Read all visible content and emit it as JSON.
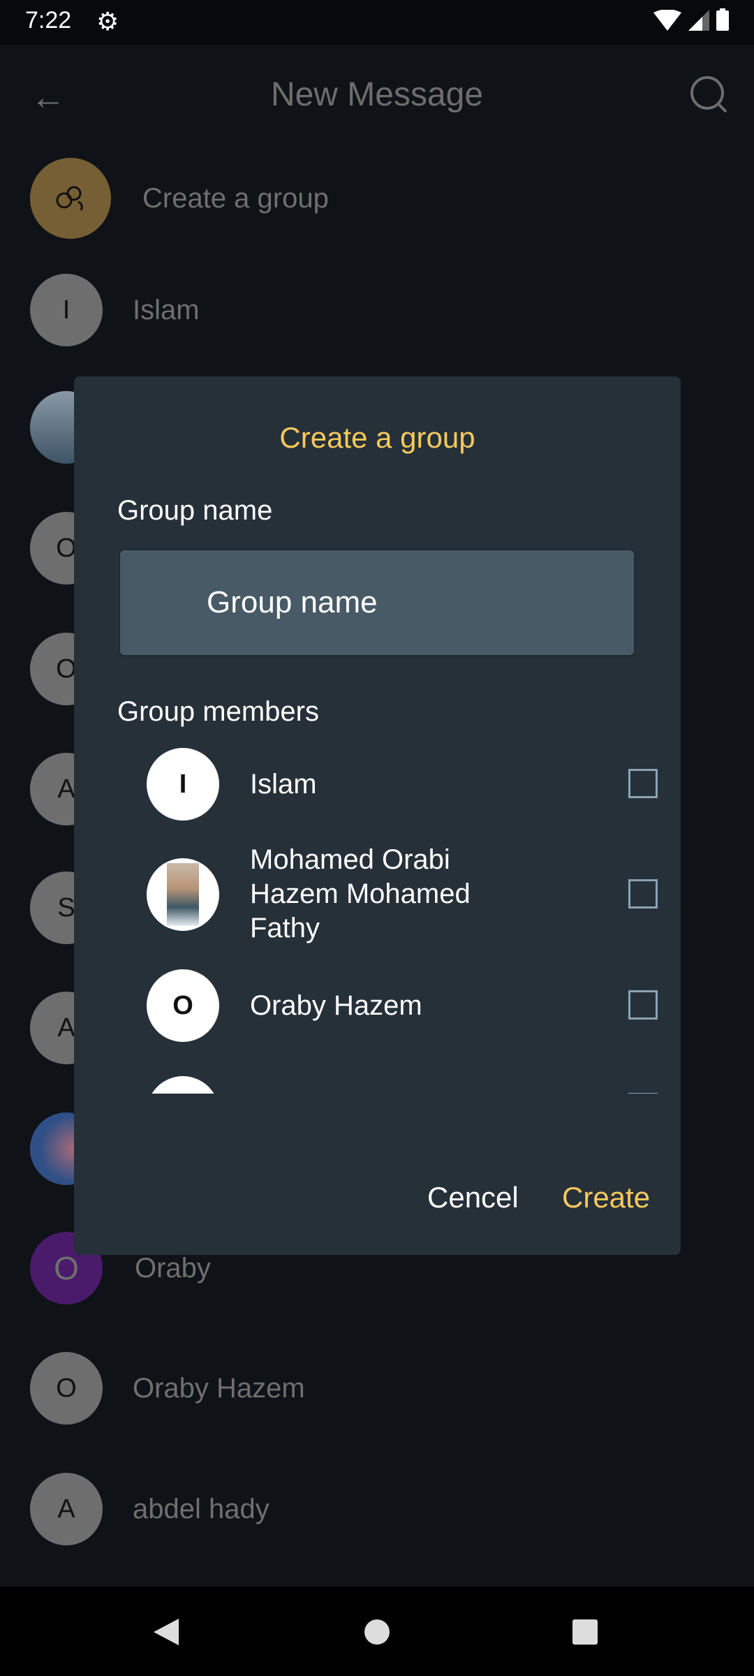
{
  "status_bar": {
    "time": "7:22",
    "icons": [
      "settings-gear-icon",
      "wifi-icon",
      "cell-signal-icon",
      "battery-icon"
    ]
  },
  "header": {
    "title": "New Message",
    "back_icon": "back-arrow-icon",
    "search_icon": "search-icon"
  },
  "list": {
    "create_group_label": "Create a group",
    "contacts": [
      {
        "initial": "I",
        "name": "Islam"
      },
      {
        "initial": "",
        "name": "",
        "photo": true
      },
      {
        "initial": "O",
        "name": ""
      },
      {
        "initial": "O",
        "name": ""
      },
      {
        "initial": "A",
        "name": ""
      },
      {
        "initial": "S",
        "name": ""
      },
      {
        "initial": "A",
        "name": ""
      },
      {
        "initial": "",
        "name": "",
        "photo": true
      },
      {
        "initial": "O",
        "name": "Oraby",
        "avatar_color": "#4a1a6b"
      },
      {
        "initial": "O",
        "name": "Oraby Hazem"
      },
      {
        "initial": "A",
        "name": "abdel hady"
      }
    ]
  },
  "dialog": {
    "title": "Create a group",
    "group_name_label": "Group name",
    "group_name_placeholder": "Group name",
    "members_label": "Group members",
    "members": [
      {
        "initial": "I",
        "name": "Islam",
        "checked": false
      },
      {
        "initial": "",
        "name": "Mohamed Orabi Hazem Mohamed Fathy",
        "photo": true,
        "checked": false
      },
      {
        "initial": "O",
        "name": "Oraby Hazem",
        "checked": false
      },
      {
        "initial": "",
        "name": "",
        "checked": false
      }
    ],
    "cancel_label": "Cencel",
    "create_label": "Create",
    "accent_color": "#f6c95c"
  }
}
